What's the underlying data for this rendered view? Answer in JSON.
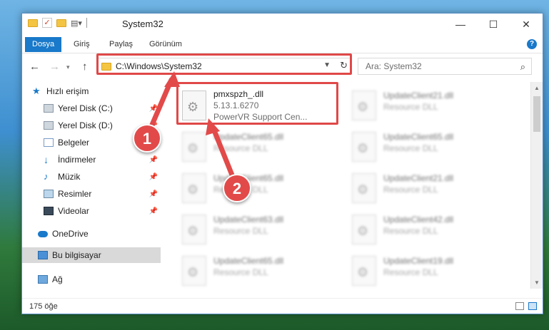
{
  "window": {
    "title": "System32",
    "controls": {
      "minimize": "—",
      "maximize": "☐",
      "close": "✕"
    }
  },
  "ribbon": {
    "tabs": [
      {
        "label": "Dosya",
        "active": true
      },
      {
        "label": "Giriş",
        "active": false
      },
      {
        "label": "Paylaş",
        "active": false
      },
      {
        "label": "Görünüm",
        "active": false
      }
    ],
    "help": "?"
  },
  "nav": {
    "address": "C:\\Windows\\System32",
    "search_placeholder": "Ara: System32"
  },
  "sidebar": {
    "items": [
      {
        "label": "Hızlı erişim",
        "icon": "star-icon",
        "pinned": false
      },
      {
        "label": "Yerel Disk (C:)",
        "icon": "drive-icon",
        "pinned": true
      },
      {
        "label": "Yerel Disk (D:)",
        "icon": "drive-icon",
        "pinned": true
      },
      {
        "label": "Belgeler",
        "icon": "documents-icon",
        "pinned": true
      },
      {
        "label": "İndirmeler",
        "icon": "download-icon",
        "pinned": true
      },
      {
        "label": "Müzik",
        "icon": "music-icon",
        "pinned": true
      },
      {
        "label": "Resimler",
        "icon": "pictures-icon",
        "pinned": true
      },
      {
        "label": "Videolar",
        "icon": "videos-icon",
        "pinned": true
      },
      {
        "label": "OneDrive",
        "icon": "cloud-icon",
        "pinned": false
      },
      {
        "label": "Bu bilgisayar",
        "icon": "computer-icon",
        "pinned": false,
        "selected": true
      },
      {
        "label": "Ağ",
        "icon": "network-icon",
        "pinned": false
      }
    ]
  },
  "files": {
    "highlighted": {
      "name": "pmxspzh_.dll",
      "version": "5.13.1.6270",
      "description": "PowerVR Support Cen..."
    },
    "others": [
      {
        "name": "UpdateClient21.dll",
        "type": "Resource DLL"
      },
      {
        "name": "UpdateClient65.dll",
        "type": "Resource DLL"
      },
      {
        "name": "UpdateClient65.dll",
        "type": "Resource DLL"
      },
      {
        "name": "UpdateClient65.dll",
        "type": "Resource DLL"
      },
      {
        "name": "UpdateClient21.dll",
        "type": "Resource DLL"
      },
      {
        "name": "UpdateClient63.dll",
        "type": "Resource DLL"
      },
      {
        "name": "UpdateClient42.dll",
        "type": "Resource DLL"
      },
      {
        "name": "UpdateClient65.dll",
        "type": "Resource DLL"
      },
      {
        "name": "UpdateClient19.dll",
        "type": "Resource DLL"
      }
    ]
  },
  "status": {
    "count": "175 öğe"
  },
  "callouts": {
    "one": "1",
    "two": "2"
  },
  "colors": {
    "accent": "#1979ca",
    "highlight": "#e04848"
  }
}
